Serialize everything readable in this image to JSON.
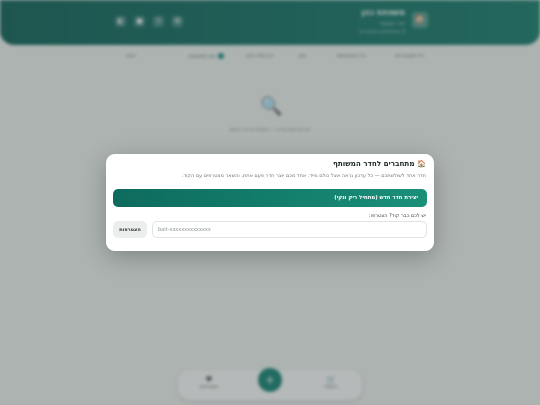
{
  "header": {
    "logo_icon": "🏠",
    "title": "משפחת כהן",
    "subtitle": "חדר משותף",
    "subtitle2": "3 משתתפים מחוברים",
    "icons": [
      "settings-icon",
      "share-icon",
      "bell-icon",
      "user-icon"
    ]
  },
  "toolbar": {
    "items": [
      "כל הקטגוריות",
      "כל הסטטוסים",
      "מיון",
      "רק שלא נקנו",
      "הצג מסומנים",
      "ייצוא"
    ]
  },
  "empty_state": {
    "icon": "🔍",
    "text": "אין פריטים עדיין — הוסיפו פריט ראשון"
  },
  "bottom_nav": {
    "items": [
      "רשימה",
      "הוספה",
      "מועדפים"
    ],
    "center_icon": "+"
  },
  "modal": {
    "title_icon": "🏠",
    "title": "מתחברים לחדר המשותף",
    "description": "חדר אחד לשולשתכם — כל עדכון נראה אצל כולם מייד. אחד מכם יוצר חדר פעם אחת, והשאר מצטרפים עם הקוד.",
    "create_button": "יצירת חדר חדש (מתחיל ריק ונקי)",
    "join_label": "יש לכם כבר קוד? הצטרפו:",
    "code_placeholder": "bait-xxxxxxxxxxxxxx",
    "code_value": "",
    "join_button": "הצטרפות"
  }
}
